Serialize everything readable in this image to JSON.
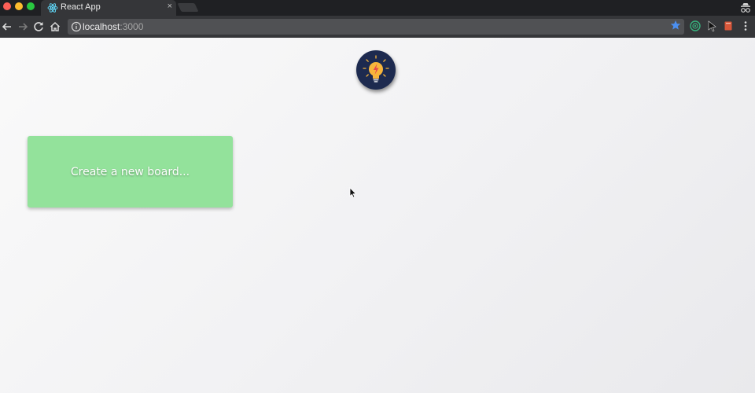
{
  "browser": {
    "tab": {
      "title": "React App",
      "close_glyph": "×",
      "favicon": "react-icon"
    },
    "address_bar": {
      "host": "localhost",
      "port": ":3000"
    },
    "toolbar_icons": [
      "back-arrow-icon",
      "forward-arrow-icon",
      "reload-icon",
      "home-icon",
      "info-icon",
      "bookmark-star-icon",
      "extension-target-icon",
      "extension-cursor-icon",
      "extension-book-icon",
      "menu-dots-icon"
    ]
  },
  "app": {
    "logo": "lightbulb-icon",
    "new_board_label": "Create a new board..."
  },
  "colors": {
    "card": "#93e29b",
    "logo_bg": "#1d2a4f",
    "bulb": "#f7b53b",
    "star": "#4b8ff0"
  }
}
